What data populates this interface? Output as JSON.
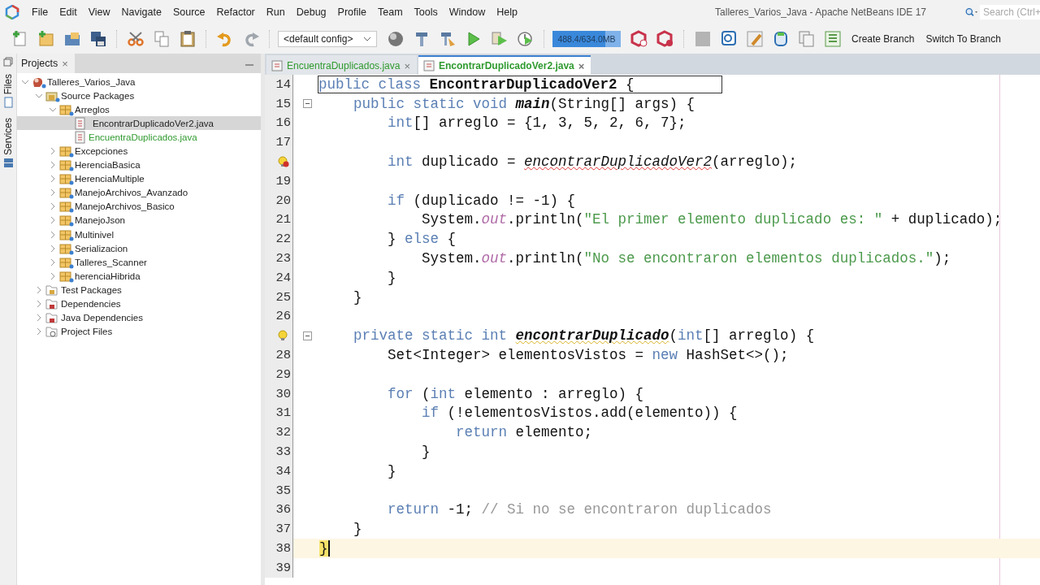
{
  "window": {
    "title": "Talleres_Varios_Java - Apache NetBeans IDE 17"
  },
  "menu": [
    "File",
    "Edit",
    "View",
    "Navigate",
    "Source",
    "Refactor",
    "Run",
    "Debug",
    "Profile",
    "Team",
    "Tools",
    "Window",
    "Help"
  ],
  "search": {
    "placeholder": "Search (Ctrl+"
  },
  "toolbar": {
    "config": "<default config>",
    "memory": {
      "reading": "488.4/634.0MB",
      "level": 0.77
    },
    "buttons": [
      "Create Branch",
      "Switch To Branch"
    ]
  },
  "side_tabs": [
    "Files",
    "Services"
  ],
  "projects_panel": {
    "title": "Projects",
    "close": "×",
    "tree": [
      {
        "label": "Talleres_Varios_Java",
        "kind": "project",
        "expanded": true,
        "selected": false,
        "children": [
          {
            "label": "Source Packages",
            "kind": "source-root",
            "expanded": true,
            "selected": false,
            "children": [
              {
                "label": "Arreglos",
                "kind": "package",
                "expanded": true,
                "selected": false,
                "children": [
                  {
                    "label": "EncontrarDuplicadoVer2.java",
                    "kind": "java-file",
                    "selected": true
                  },
                  {
                    "label": "EncuentraDuplicados.java",
                    "kind": "java-file",
                    "selected": false,
                    "color": "#2f9a2f"
                  }
                ]
              },
              {
                "label": "Excepciones",
                "kind": "package",
                "expanded": false,
                "selected": false
              },
              {
                "label": "HerenciaBasica",
                "kind": "package",
                "expanded": false,
                "selected": false
              },
              {
                "label": "HerenciaMultiple",
                "kind": "package",
                "expanded": false,
                "selected": false
              },
              {
                "label": "ManejoArchivos_Avanzado",
                "kind": "package",
                "expanded": false,
                "selected": false
              },
              {
                "label": "ManejoArchivos_Basico",
                "kind": "package",
                "expanded": false,
                "selected": false
              },
              {
                "label": "ManejoJson",
                "kind": "package",
                "expanded": false,
                "selected": false
              },
              {
                "label": "Multinivel",
                "kind": "package",
                "expanded": false,
                "selected": false
              },
              {
                "label": "Serializacion",
                "kind": "package",
                "expanded": false,
                "selected": false
              },
              {
                "label": "Talleres_Scanner",
                "kind": "package",
                "expanded": false,
                "selected": false
              },
              {
                "label": "herenciaHibrida",
                "kind": "package",
                "expanded": false,
                "selected": false
              }
            ]
          },
          {
            "label": "Test Packages",
            "kind": "test-root",
            "expanded": false,
            "selected": false
          },
          {
            "label": "Dependencies",
            "kind": "library",
            "expanded": false,
            "selected": false
          },
          {
            "label": "Java Dependencies",
            "kind": "library",
            "expanded": false,
            "selected": false
          },
          {
            "label": "Project Files",
            "kind": "project-files",
            "expanded": false,
            "selected": false
          }
        ]
      }
    ]
  },
  "editor": {
    "tabs": [
      {
        "label": "EncuentraDuplicados.java",
        "close": "×",
        "selected": false
      },
      {
        "label": "EncontrarDuplicadoVer2.java",
        "close": "×",
        "selected": true
      }
    ],
    "lines": [
      {
        "number": "14",
        "pinned": true,
        "segments": [
          {
            "kind": "keyword",
            "text": "public class "
          },
          {
            "kind": "bold",
            "text": "EncontrarDuplicadoVer2"
          },
          {
            "kind": "plain",
            "text": " {"
          }
        ]
      },
      {
        "number": "15",
        "fold": true,
        "segments": [
          {
            "kind": "keyword",
            "text": "    public static void "
          },
          {
            "kind": "method",
            "text": "main"
          },
          {
            "kind": "plain",
            "text": "(String[] args) {"
          }
        ]
      },
      {
        "number": "16",
        "segments": [
          {
            "kind": "keyword",
            "text": "        int"
          },
          {
            "kind": "plain",
            "text": "[] arreglo = {1, 3, 5, 2, 6, 7};"
          }
        ]
      },
      {
        "number": "17"
      },
      {
        "error": true,
        "segments": [
          {
            "kind": "keyword",
            "text": "        int"
          },
          {
            "kind": "plain",
            "text": " duplicado = "
          },
          {
            "kind": "error-call",
            "text": "encontrarDuplicadoVer2"
          },
          {
            "kind": "plain",
            "text": "(arreglo);"
          }
        ]
      },
      {
        "number": "19"
      },
      {
        "number": "20",
        "segments": [
          {
            "kind": "keyword",
            "text": "        if"
          },
          {
            "kind": "plain",
            "text": " (duplicado != -1) {"
          }
        ]
      },
      {
        "number": "21",
        "segments": [
          {
            "kind": "plain",
            "text": "            System."
          },
          {
            "kind": "static",
            "text": "out"
          },
          {
            "kind": "plain",
            "text": ".println("
          },
          {
            "kind": "string",
            "text": "\"El primer elemento duplicado es: \""
          },
          {
            "kind": "plain",
            "text": " + duplicado);"
          }
        ]
      },
      {
        "number": "22",
        "segments": [
          {
            "kind": "plain",
            "text": "        } "
          },
          {
            "kind": "keyword",
            "text": "else"
          },
          {
            "kind": "plain",
            "text": " {"
          }
        ]
      },
      {
        "number": "23",
        "segments": [
          {
            "kind": "plain",
            "text": "            System."
          },
          {
            "kind": "static",
            "text": "out"
          },
          {
            "kind": "plain",
            "text": ".println("
          },
          {
            "kind": "string",
            "text": "\"No se encontraron elementos duplicados.\""
          },
          {
            "kind": "plain",
            "text": ");"
          }
        ]
      },
      {
        "number": "24",
        "segments": [
          {
            "kind": "plain",
            "text": "        }"
          }
        ]
      },
      {
        "number": "25",
        "segments": [
          {
            "kind": "plain",
            "text": "    }"
          }
        ]
      },
      {
        "number": "26"
      },
      {
        "warning": true,
        "fold": true,
        "segments": [
          {
            "kind": "keyword",
            "text": "    private static int "
          },
          {
            "kind": "warning-method",
            "text": "encontrarDuplicado"
          },
          {
            "kind": "plain",
            "text": "("
          },
          {
            "kind": "keyword",
            "text": "int"
          },
          {
            "kind": "plain",
            "text": "[] arreglo) {"
          }
        ]
      },
      {
        "number": "28",
        "segments": [
          {
            "kind": "plain",
            "text": "        Set<Integer> elementosVistos = "
          },
          {
            "kind": "keyword",
            "text": "new"
          },
          {
            "kind": "plain",
            "text": " HashSet<>();"
          }
        ]
      },
      {
        "number": "29"
      },
      {
        "number": "30",
        "segments": [
          {
            "kind": "keyword",
            "text": "        for"
          },
          {
            "kind": "plain",
            "text": " ("
          },
          {
            "kind": "keyword",
            "text": "int"
          },
          {
            "kind": "plain",
            "text": " elemento : arreglo) {"
          }
        ]
      },
      {
        "number": "31",
        "segments": [
          {
            "kind": "keyword",
            "text": "            if"
          },
          {
            "kind": "plain",
            "text": " (!elementosVistos.add(elemento)) {"
          }
        ]
      },
      {
        "number": "32",
        "segments": [
          {
            "kind": "keyword",
            "text": "                return"
          },
          {
            "kind": "plain",
            "text": " elemento;"
          }
        ]
      },
      {
        "number": "33",
        "segments": [
          {
            "kind": "plain",
            "text": "            }"
          }
        ]
      },
      {
        "number": "34",
        "segments": [
          {
            "kind": "plain",
            "text": "        }"
          }
        ]
      },
      {
        "number": "35"
      },
      {
        "number": "36",
        "segments": [
          {
            "kind": "keyword",
            "text": "        return"
          },
          {
            "kind": "plain",
            "text": " -1; "
          },
          {
            "kind": "comment",
            "text": "// Si no se encontraron duplicados"
          }
        ]
      },
      {
        "number": "37",
        "segments": [
          {
            "kind": "plain",
            "text": "    }"
          }
        ]
      },
      {
        "number": "38",
        "current": true,
        "segments": [
          {
            "kind": "bracket-match",
            "text": "}"
          }
        ]
      },
      {
        "number": "39"
      }
    ]
  }
}
